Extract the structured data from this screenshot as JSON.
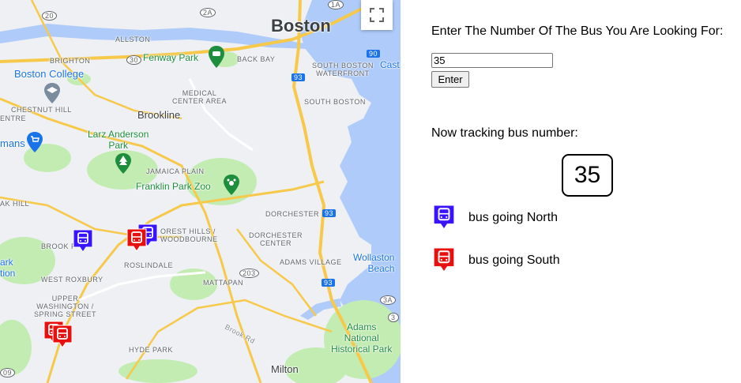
{
  "colors": {
    "north": "#3b14ff",
    "south": "#e8100e",
    "water": "#aecbfa",
    "park": "#c3ecb2",
    "highway": "#f6c94b",
    "land": "#eef0f3"
  },
  "map": {
    "icons": {
      "fullscreen": "fullscreen-icon",
      "bus_marker": "bus-icon",
      "park_poi": "tree-icon",
      "zoo_poi": "paw-icon",
      "stadium_poi": "stadium-icon",
      "college_poi": "graduation-cap-icon",
      "shopping_poi": "shopping-cart-icon"
    },
    "labels": {
      "boston": "Boston",
      "allston": "ALLSTON",
      "brighton": "BRIGHTON",
      "boston_college": "Boston College",
      "fenway_park": "Fenway Park",
      "back_bay": "BACK BAY",
      "south_boston_waterfront": "SOUTH BOSTON\nWATERFRONT",
      "castle": "Cast",
      "medical_center_area": "MEDICAL\nCENTER AREA",
      "south_boston": "SOUTH BOSTON",
      "chestnut_hill": "CHESTNUT HILL",
      "centre": "ENTRE",
      "brookline": "Brookline",
      "mans": "mans",
      "larz_anderson_park": "Larz Anderson\nPark",
      "jamaica_plain": "JAMAICA PLAIN",
      "franklin_park_zoo": "Franklin Park Zoo",
      "oak_hill": "AK HILL",
      "dorchester": "DORCHESTER",
      "forest_hills": "OREST HILLS /\nWOODBOURNE",
      "brook_farm": "BROOK F",
      "dorchester_center": "DORCHESTER\nCENTER",
      "park_stion": "ark\ntion",
      "roslindale": "ROSLINDALE",
      "adams_village": "ADAMS VILLAGE",
      "wollaston_beach": "Wollaston\nBeach",
      "west_roxbury": "WEST ROXBURY",
      "mattapan": "MATTAPAN",
      "upper_washington": "UPPER\nWASHINGTON /\nSPRING STREET",
      "hyde_park": "HYDE PARK",
      "brook_rd": "Brook Rd",
      "adams_nhp": "Adams\nNational\nHistorical Park",
      "milton": "Milton",
      "shield_20": "20",
      "shield_2a": "2A",
      "shield_1a": "1A",
      "shield_30": "30",
      "shield_90": "90",
      "shield_93a": "93",
      "shield_93b": "93",
      "shield_93c": "93",
      "shield_203": "203",
      "shield_3a": "3A",
      "shield_3": "3",
      "shield_09": "09"
    }
  },
  "panel": {
    "prompt": "Enter The Number Of The Bus You Are Looking For:",
    "input_value": "35",
    "enter_label": "Enter",
    "tracking_label": "Now tracking bus number:",
    "tracking_number": "35",
    "legend": [
      {
        "label": "bus going North",
        "color": "north",
        "icon": "bus-icon"
      },
      {
        "label": "bus going South",
        "color": "south",
        "icon": "bus-icon"
      }
    ]
  }
}
